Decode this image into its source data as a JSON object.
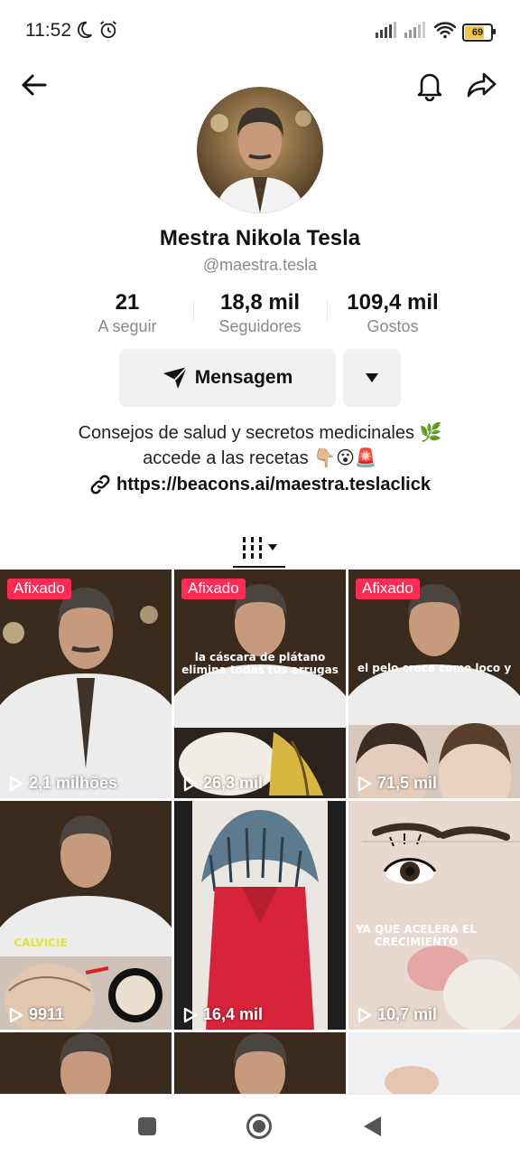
{
  "status": {
    "time": "11:52",
    "battery": "69"
  },
  "profile": {
    "name": "Mestra Nikola Tesla",
    "handle": "@maestra.tesla"
  },
  "stats": [
    {
      "value": "21",
      "label": "A seguir"
    },
    {
      "value": "18,8 mil",
      "label": "Seguidores"
    },
    {
      "value": "109,4 mil",
      "label": "Gostos"
    }
  ],
  "actions": {
    "message_label": "Mensagem"
  },
  "bio": {
    "line1": "Consejos de salud y secretos medicinales 🌿",
    "line2": "accede a las recetas 👇🏼😮🚨",
    "link": "https://beacons.ai/maestra.teslaclick"
  },
  "videos": [
    {
      "pinned": "Afixado",
      "views": "2,1 milhões",
      "caption": ""
    },
    {
      "pinned": "Afixado",
      "views": "26,3 mil",
      "caption": "la cáscara de plátano elimina todas tus arrugas"
    },
    {
      "pinned": "Afixado",
      "views": "71,5 mil",
      "caption": "el pelo crece como loco y"
    },
    {
      "pinned": "",
      "views": "9911",
      "caption": "CALVICIE"
    },
    {
      "pinned": "",
      "views": "16,4 mil",
      "caption": ""
    },
    {
      "pinned": "",
      "views": "10,7 mil",
      "caption": "YA QUE ACELERA EL CRECIMIENTO"
    }
  ],
  "colors": {
    "pinned_badge": "#fe2c55",
    "button_bg": "#f1f1f2",
    "muted_text": "#8a8a8a"
  }
}
